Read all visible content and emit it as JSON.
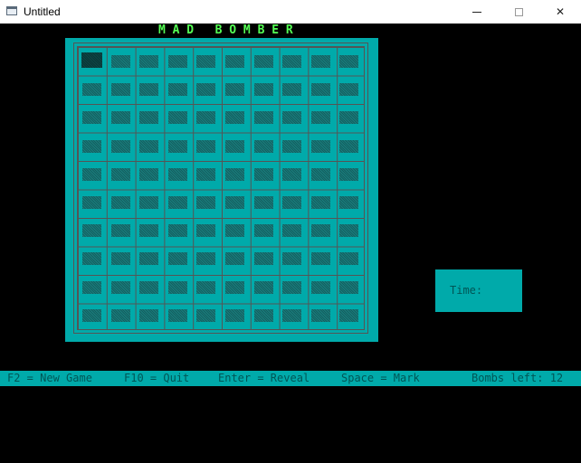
{
  "window": {
    "title": "Untitled",
    "minimize": "—",
    "maximize": "☐",
    "close": "✕"
  },
  "game": {
    "title": "M A D   B O M B E R",
    "grid_rows": 10,
    "grid_cols": 10
  },
  "time_panel": {
    "label": "Time:"
  },
  "statusbar": {
    "new_game": "F2 = New Game",
    "quit": "F10 = Quit",
    "reveal": "Enter = Reveal",
    "mark": "Space = Mark",
    "bombs_left": "Bombs left: 12"
  }
}
